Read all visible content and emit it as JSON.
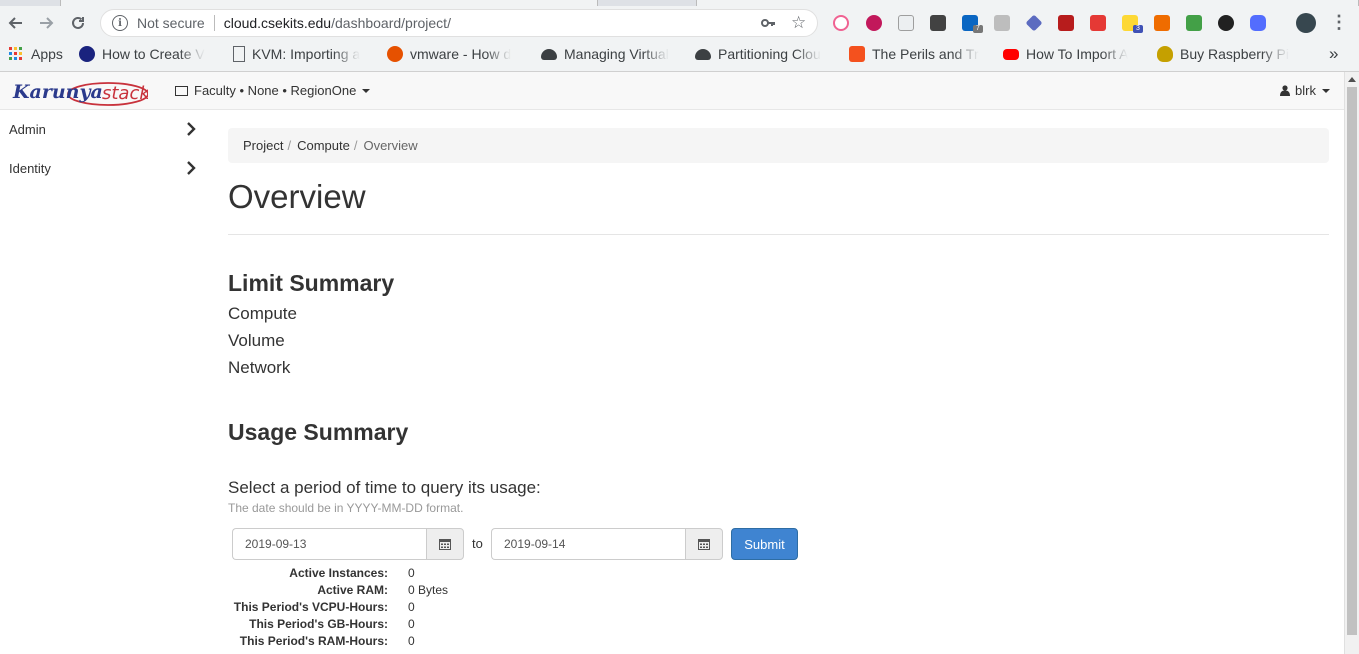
{
  "browser": {
    "omnibox": {
      "security_label": "Not secure",
      "host": "cloud.csekits.edu",
      "path": "/dashboard/project/"
    },
    "extension_badges": [
      "7",
      "3"
    ],
    "bookmarks": [
      {
        "label": "Apps",
        "icon": "apps-grid-icon"
      },
      {
        "label": "How to Create V",
        "icon": "globe-icon"
      },
      {
        "label": "KVM: Importing a",
        "icon": "page-icon"
      },
      {
        "label": "vmware - How d",
        "icon": "askubuntu-icon"
      },
      {
        "label": "Managing Virtual",
        "icon": "cloud-icon"
      },
      {
        "label": "Partitioning Clou",
        "icon": "cloud-icon"
      },
      {
        "label": "The Perils and Tr",
        "icon": "blogger-icon"
      },
      {
        "label": "How To Import A",
        "icon": "youtube-icon"
      },
      {
        "label": "Buy Raspberry Pi",
        "icon": "raspberry-icon"
      }
    ]
  },
  "header": {
    "logo_text": "Karunya stack",
    "context": "Faculty • None • RegionOne",
    "user": "blrk"
  },
  "sidebar": {
    "items": [
      {
        "label": "Admin"
      },
      {
        "label": "Identity"
      }
    ]
  },
  "breadcrumb": {
    "items": [
      "Project",
      "Compute"
    ],
    "active": "Overview",
    "separator": "/"
  },
  "page": {
    "title": "Overview",
    "limit_heading": "Limit Summary",
    "limit_items": [
      "Compute",
      "Volume",
      "Network"
    ],
    "usage_heading": "Usage Summary",
    "usage_prompt": "Select a period of time to query its usage:",
    "usage_help": "The date should be in YYYY-MM-DD format.",
    "start_date": "2019-09-13",
    "to_label": "to",
    "end_date": "2019-09-14",
    "submit_label": "Submit",
    "stats": [
      {
        "label": "Active Instances:",
        "value": "0"
      },
      {
        "label": "Active RAM:",
        "value": "0 Bytes"
      },
      {
        "label": "This Period's VCPU-Hours:",
        "value": "0"
      },
      {
        "label": "This Period's GB-Hours:",
        "value": "0"
      },
      {
        "label": "This Period's RAM-Hours:",
        "value": "0"
      }
    ]
  },
  "colors": {
    "primary_button": "#3f84d1",
    "logo_text": "#2b3a8c",
    "logo_accent": "#c8323c"
  }
}
